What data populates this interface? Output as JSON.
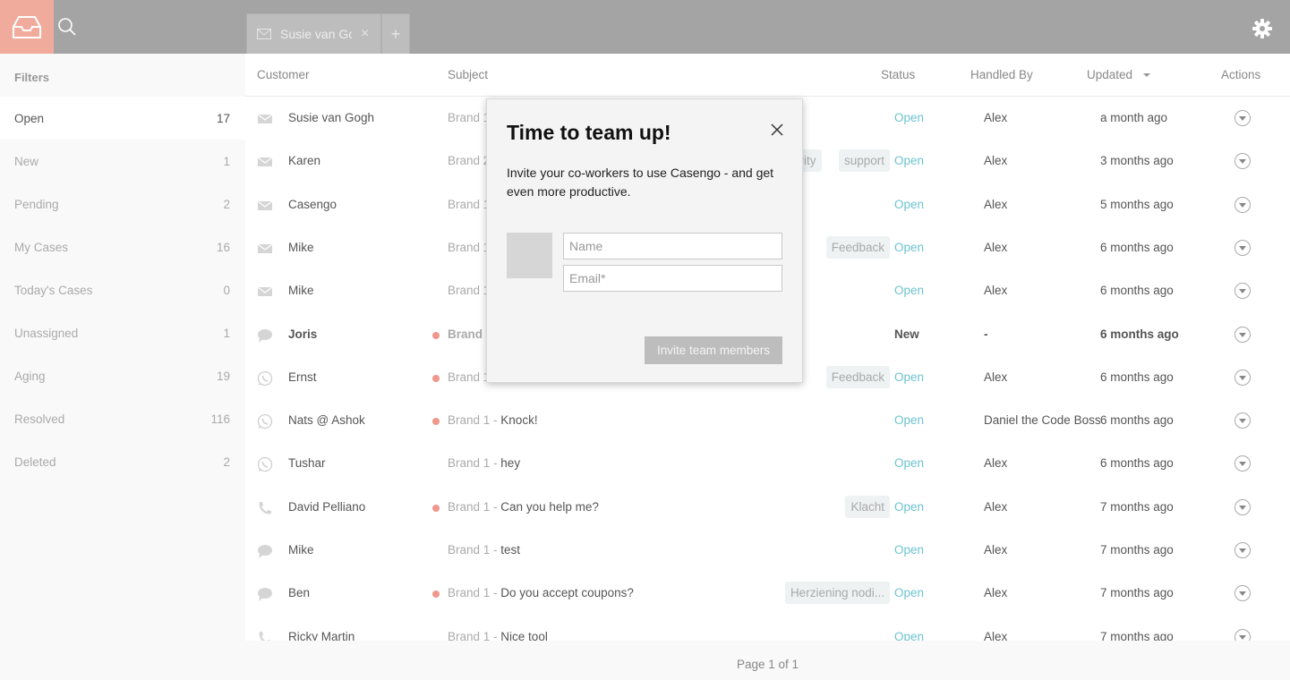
{
  "topbar": {
    "tab_label": "Susie van Gogh",
    "tab_close": "×",
    "new_tab": "+",
    "accent": "#f0ab9c"
  },
  "sidebar": {
    "title": "Filters",
    "items": [
      {
        "label": "Open",
        "count": "17"
      },
      {
        "label": "New",
        "count": "1"
      },
      {
        "label": "Pending",
        "count": "2"
      },
      {
        "label": "My Cases",
        "count": "16"
      },
      {
        "label": "Today's Cases",
        "count": "0"
      },
      {
        "label": "Unassigned",
        "count": "1"
      },
      {
        "label": "Aging",
        "count": "19"
      },
      {
        "label": "Resolved",
        "count": "116"
      },
      {
        "label": "Deleted",
        "count": "2"
      }
    ]
  },
  "table": {
    "headers": {
      "customer": "Customer",
      "subject": "Subject",
      "status": "Status",
      "handled_by": "Handled By",
      "updated": "Updated",
      "actions": "Actions"
    },
    "rows": [
      {
        "icon": "mail-icon",
        "customer": "Susie van Gogh",
        "brand": "Brand 1",
        "subject": "",
        "tags": [],
        "status": "Open",
        "handled_by": "Alex",
        "updated": "a month ago",
        "dot": false,
        "bold": false
      },
      {
        "icon": "mail-icon",
        "customer": "Karen",
        "brand": "Brand 2",
        "subject": "",
        "tags": [
          "priority",
          "support"
        ],
        "status": "Open",
        "handled_by": "Alex",
        "updated": "3 months ago",
        "dot": false,
        "bold": false
      },
      {
        "icon": "mail-icon",
        "customer": "Casengo",
        "brand": "Brand 1",
        "subject": "",
        "tags": [],
        "status": "Open",
        "handled_by": "Alex",
        "updated": "5 months ago",
        "dot": false,
        "bold": false
      },
      {
        "icon": "mail-icon",
        "customer": "Mike",
        "brand": "Brand 1",
        "subject": "",
        "tags": [
          "Feedback"
        ],
        "status": "Open",
        "handled_by": "Alex",
        "updated": "6 months ago",
        "dot": false,
        "bold": false
      },
      {
        "icon": "mail-icon",
        "customer": "Mike",
        "brand": "Brand 1",
        "subject": "",
        "tags": [],
        "status": "Open",
        "handled_by": "Alex",
        "updated": "6 months ago",
        "dot": false,
        "bold": false
      },
      {
        "icon": "chat-icon",
        "customer": "Joris",
        "brand": "Brand 1",
        "subject": "",
        "tags": [],
        "status": "New",
        "handled_by": "-",
        "updated": "6 months ago",
        "dot": true,
        "bold": true
      },
      {
        "icon": "whatsapp-icon",
        "customer": "Ernst",
        "brand": "Brand 1",
        "subject": "",
        "tags": [
          "Feedback"
        ],
        "status": "Open",
        "handled_by": "Alex",
        "updated": "6 months ago",
        "dot": true,
        "bold": false
      },
      {
        "icon": "whatsapp-icon",
        "customer": "Nats @ Ashok",
        "brand": "Brand 1",
        "subject": "Knock!",
        "tags": [],
        "status": "Open",
        "handled_by": "Daniel the Code Boss",
        "updated": "6 months ago",
        "dot": true,
        "bold": false
      },
      {
        "icon": "whatsapp-icon",
        "customer": "Tushar",
        "brand": "Brand 1",
        "subject": "hey",
        "tags": [],
        "status": "Open",
        "handled_by": "Alex",
        "updated": "6 months ago",
        "dot": false,
        "bold": false
      },
      {
        "icon": "phone-icon",
        "customer": "David Pelliano",
        "brand": "Brand 1",
        "subject": "Can you help me?",
        "tags": [
          "Klacht"
        ],
        "status": "Open",
        "handled_by": "Alex",
        "updated": "7 months ago",
        "dot": true,
        "bold": false
      },
      {
        "icon": "chat-icon",
        "customer": "Mike",
        "brand": "Brand 1",
        "subject": "test",
        "tags": [],
        "status": "Open",
        "handled_by": "Alex",
        "updated": "7 months ago",
        "dot": false,
        "bold": false
      },
      {
        "icon": "chat-icon",
        "customer": "Ben",
        "brand": "Brand 1",
        "subject": "Do you accept coupons?",
        "tags": [
          "Herziening nodi..."
        ],
        "status": "Open",
        "handled_by": "Alex",
        "updated": "7 months ago",
        "dot": true,
        "bold": false
      },
      {
        "icon": "phone-icon",
        "customer": "Ricky Martin",
        "brand": "Brand 1",
        "subject": "Nice tool",
        "tags": [],
        "status": "Open",
        "handled_by": "Alex",
        "updated": "7 months ago",
        "dot": false,
        "bold": false
      }
    ]
  },
  "footer": {
    "pagination": "Page 1 of 1"
  },
  "modal": {
    "title": "Time to team up!",
    "text": "Invite your co-workers to use Casengo - and get even more productive.",
    "name_placeholder": "Name",
    "email_placeholder": "Email*",
    "button": "Invite team members"
  }
}
